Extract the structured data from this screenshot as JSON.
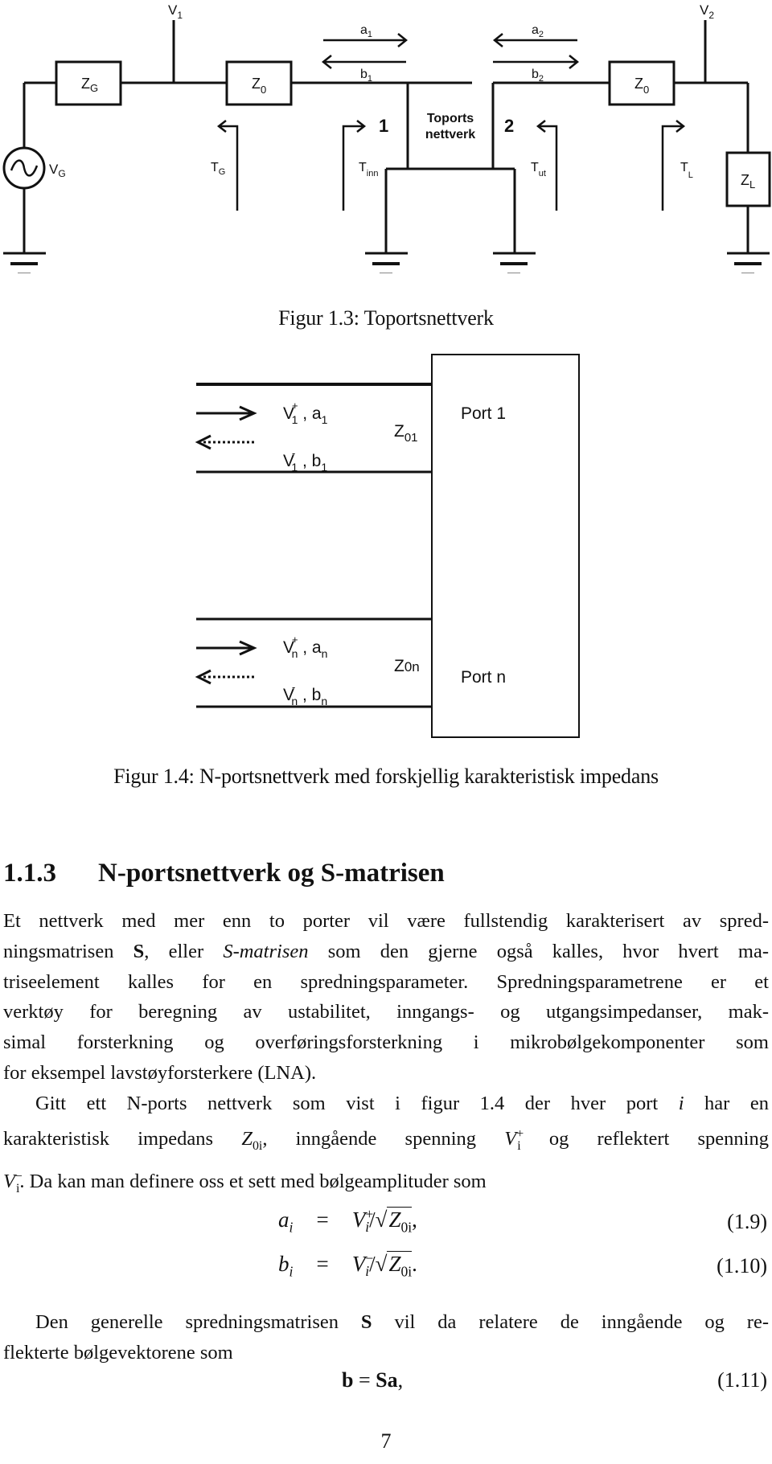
{
  "figure_1_3": {
    "labels": {
      "v1": "V",
      "v1_sub": "1",
      "v2": "V",
      "v2_sub": "2",
      "zg": "Z",
      "zg_sub": "G",
      "z0_left": "Z",
      "z0_left_sub": "0",
      "z0_right": "Z",
      "z0_right_sub": "0",
      "zl": "Z",
      "zl_sub": "L",
      "vg": "V",
      "vg_sub": "G",
      "a1": "a",
      "a1_sub": "1",
      "b1": "b",
      "b1_sub": "1",
      "a2": "a",
      "a2_sub": "2",
      "b2": "b",
      "b2_sub": "2",
      "tg": "T",
      "tg_sub": "G",
      "tinn": "T",
      "tinn_sub": "inn",
      "tut": "T",
      "tut_sub": "ut",
      "tl": "T",
      "tl_sub": "L",
      "port1": "1",
      "port2": "2",
      "network_line1": "Toports",
      "network_line2": "nettverk"
    },
    "caption": "Figur 1.3: Toportsnettverk"
  },
  "figure_1_4": {
    "labels": {
      "v1p": "V",
      "v1p_sub": "1",
      "v1p_sup": "+",
      "a1": "a",
      "a1_sub": "1",
      "v1m": "V",
      "v1m_sub": "1",
      "v1m_sup": "-",
      "b1": "b",
      "b1_sub": "1",
      "z01": "Z",
      "z01_sub": "01",
      "port1": "Port 1",
      "vnp": "V",
      "vnp_sub": "n",
      "vnp_sup": "+",
      "an": "a",
      "an_sub": "n",
      "vnm": "V",
      "vnm_sub": "n",
      "vnm_sup": "-",
      "bn": "b",
      "bn_sub": "n",
      "z0n": "Z",
      "z0n_sub": "0n",
      "portn": "Port n",
      "sep": " , "
    },
    "caption": "Figur 1.4: N-portsnettverk med forskjellig karakteristisk impedans"
  },
  "section": {
    "number": "1.1.3",
    "title": "N-portsnettverk og S-matrisen"
  },
  "paragraph1": {
    "l1": "Et nettverk med mer enn to porter vil være fullstendig karakterisert av spred-",
    "l2a": "ningsmatrisen ",
    "l2b": "S",
    "l2c": ", eller ",
    "l2d": "S-matrisen",
    "l2e": " som den gjerne også kalles, hvor hvert ma-",
    "l3": "triseelement kalles for en spredningsparameter. Spredningsparametrene er et",
    "l4": "verktøy for beregning av ustabilitet, inngangs- og utgangsimpedanser, mak-",
    "l5": "simal forsterkning og overføringsforsterkning i mikrobølgekomponenter som",
    "l6": "for eksempel lavstøyforsterkere (LNA)."
  },
  "paragraph2": {
    "l1a": "Gitt ett N-ports nettverk som vist i figur 1.4 der hver port ",
    "l1b": "i",
    "l1c": " har en",
    "l2a": "karakteristisk impedans ",
    "l2_z": "Z",
    "l2_zsub": "0i",
    "l2b": ", inngående spenning ",
    "l2_v": "V",
    "l2_vsub": "i",
    "l2_vsup": "+",
    "l2c": " og reflektert spenning",
    "l3_v": "V",
    "l3_vsub": "i",
    "l3_vsup": "−",
    "l3a": ". Da kan man definere oss et sett med bølgeamplituder som"
  },
  "equations": [
    {
      "lhs": "a",
      "lhs_sub": "i",
      "eq": "=",
      "v": "V",
      "v_sub": "i",
      "v_sup": "+",
      "slash": "/",
      "z": "Z",
      "z_sub": "0i",
      "end": ",",
      "number": "(1.9)"
    },
    {
      "lhs": "b",
      "lhs_sub": "i",
      "eq": "=",
      "v": "V",
      "v_sub": "i",
      "v_sup": "−",
      "slash": "/",
      "z": "Z",
      "z_sub": "0i",
      "end": ".",
      "number": "(1.10)"
    }
  ],
  "paragraph3": {
    "l1a": "Den generelle spredningsmatrisen ",
    "l1b": "S",
    "l1c": " vil da relatere de inngående og re-",
    "l2": "flekterte bølgevektorene som"
  },
  "equation_1_11": {
    "lhs": "b",
    "eq": " = ",
    "rhs": "Sa",
    "end": ",",
    "number": "(1.11)"
  },
  "page_number": "7"
}
